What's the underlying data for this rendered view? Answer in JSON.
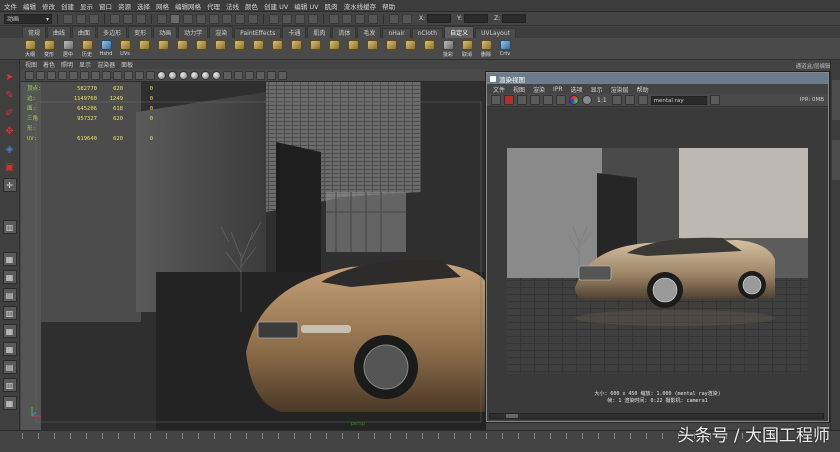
{
  "menubar": {
    "items": [
      "文件",
      "编辑",
      "修改",
      "创建",
      "显示",
      "窗口",
      "资源",
      "选择",
      "网格",
      "编辑网格",
      "代理",
      "法线",
      "颜色",
      "创建 UV",
      "编辑 UV",
      "肌肉",
      "流水线缓存",
      "帮助"
    ]
  },
  "statusline": {
    "mode": "动画",
    "coords": [
      {
        "label": "X:"
      },
      {
        "label": "Y:"
      },
      {
        "label": "Z:"
      }
    ]
  },
  "shelf": {
    "tabs": [
      "常规",
      "曲线",
      "曲面",
      "多边形",
      "变形",
      "动画",
      "动力学",
      "渲染",
      "PaintEffects",
      "卡通",
      "肌肉",
      "流体",
      "毛发",
      "nHair",
      "nCloth",
      "自定义",
      "UVLayout"
    ],
    "active_tab": 15,
    "icons": [
      {
        "label": "大纲",
        "kind": "gold"
      },
      {
        "label": "变形",
        "kind": "gold"
      },
      {
        "label": "居中",
        "kind": "gray"
      },
      {
        "label": "历史",
        "kind": "gold"
      },
      {
        "label": "Hshd",
        "kind": "blue"
      },
      {
        "label": "UVs",
        "kind": "gold"
      },
      {
        "label": "",
        "kind": "gold"
      },
      {
        "label": "",
        "kind": "gold"
      },
      {
        "label": "",
        "kind": "gold"
      },
      {
        "label": "",
        "kind": "gold"
      },
      {
        "label": "",
        "kind": "gold"
      },
      {
        "label": "",
        "kind": "gold"
      },
      {
        "label": "",
        "kind": "gold"
      },
      {
        "label": "",
        "kind": "gold"
      },
      {
        "label": "",
        "kind": "gold"
      },
      {
        "label": "",
        "kind": "gold"
      },
      {
        "label": "",
        "kind": "gold"
      },
      {
        "label": "",
        "kind": "gold"
      },
      {
        "label": "",
        "kind": "gold"
      },
      {
        "label": "",
        "kind": "gold"
      },
      {
        "label": "",
        "kind": "gold"
      },
      {
        "label": "",
        "kind": "gold"
      },
      {
        "label": "批彩",
        "kind": "gray"
      },
      {
        "label": "取消",
        "kind": "gold"
      },
      {
        "label": "删除",
        "kind": "gold"
      },
      {
        "label": "Crtv",
        "kind": "blue"
      }
    ],
    "right_label": "通道盒/层编辑器"
  },
  "viewport": {
    "menu": [
      "视图",
      "着色",
      "照明",
      "显示",
      "渲染器",
      "面板"
    ],
    "hud": [
      [
        "顶点:",
        "582770",
        "620",
        "0"
      ],
      [
        "边:",
        "1149760",
        "1249",
        "0"
      ],
      [
        "面:",
        "645206",
        "618",
        "0"
      ],
      [
        "三角形:",
        "957327",
        "620",
        "0"
      ],
      [
        "UV:",
        "619640",
        "620",
        "0"
      ]
    ],
    "status": "persp"
  },
  "render_view": {
    "title": "渲染视图",
    "menu": [
      "文件",
      "视图",
      "渲染",
      "IPR",
      "选项",
      "显示",
      "渲染层",
      "帮助"
    ],
    "ratio": "1:1",
    "renderer": "mental ray",
    "ipr_label": "IPR: 0MB",
    "info_line1": "大小: 600 x 450  缩放: 1.000         (mental ray渲染)",
    "info_line2": "帧: 1        渲染时间: 0:22         摄影机: camera1"
  },
  "watermark": "头条号 / 大国工程师"
}
